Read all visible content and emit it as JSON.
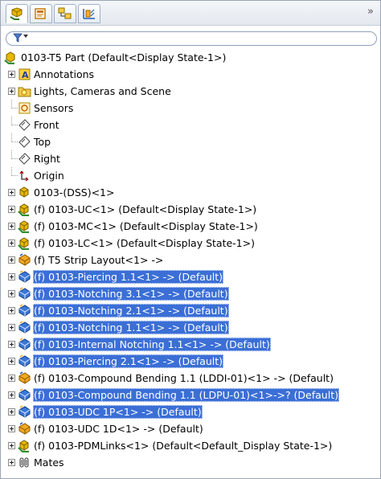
{
  "tabs": [
    {
      "name": "featuremanager-tab",
      "active": true
    },
    {
      "name": "propertymanager-tab",
      "active": false
    },
    {
      "name": "configurationmanager-tab",
      "active": false
    },
    {
      "name": "dimxpert-tab",
      "active": false
    }
  ],
  "overflow_label": "»",
  "filter": {
    "placeholder": ""
  },
  "root": {
    "label": "0103-T5 Part  (Default<Display State-1>)"
  },
  "items": [
    {
      "label": "Annotations",
      "icon": "annotations-icon",
      "expand": true,
      "sel": false
    },
    {
      "label": "Lights, Cameras and Scene",
      "icon": "lights-folder-icon",
      "expand": true,
      "sel": false
    },
    {
      "label": "Sensors",
      "icon": "sensors-icon",
      "expand": false,
      "sel": false
    },
    {
      "label": "Front",
      "icon": "plane-icon",
      "expand": false,
      "sel": false
    },
    {
      "label": "Top",
      "icon": "plane-icon",
      "expand": false,
      "sel": false
    },
    {
      "label": "Right",
      "icon": "plane-icon",
      "expand": false,
      "sel": false
    },
    {
      "label": "Origin",
      "icon": "origin-icon",
      "expand": false,
      "sel": false
    },
    {
      "label": "0103-(DSS)<1>",
      "icon": "assembly-icon",
      "expand": true,
      "sel": false
    },
    {
      "label": "(f) 0103-UC<1> (Default<Display State-1>)",
      "icon": "assembly-green-icon",
      "expand": true,
      "sel": false
    },
    {
      "label": "(f) 0103-MC<1> (Default<Display State-1>)",
      "icon": "assembly-green-icon",
      "expand": true,
      "sel": false
    },
    {
      "label": "(f) 0103-LC<1> (Default<Display State-1>)",
      "icon": "assembly-green-icon",
      "expand": true,
      "sel": false
    },
    {
      "label": "(f) T5 Strip Layout<1> ->",
      "icon": "part-icon",
      "expand": true,
      "sel": false
    },
    {
      "label": "(f) 0103-Piercing 1.1<1> -> (Default)",
      "icon": "part-blue-icon",
      "expand": true,
      "sel": true
    },
    {
      "label": "(f) 0103-Notching 3.1<1> -> (Default)",
      "icon": "part-blue-icon",
      "expand": true,
      "sel": true
    },
    {
      "label": "(f) 0103-Notching 2.1<1> -> (Default)",
      "icon": "part-blue-icon",
      "expand": true,
      "sel": true
    },
    {
      "label": "(f) 0103-Notching 1.1<1> -> (Default)",
      "icon": "part-blue-icon",
      "expand": true,
      "sel": true
    },
    {
      "label": "(f) 0103-Internal Notching 1.1<1> -> (Default)",
      "icon": "part-blue-icon",
      "expand": true,
      "sel": true
    },
    {
      "label": "(f) 0103-Piercing 2.1<1> -> (Default)",
      "icon": "part-blue-icon",
      "expand": true,
      "sel": true
    },
    {
      "label": "(f) 0103-Compound Bending 1.1 (LDDI-01)<1> -> (Default)",
      "icon": "part-icon",
      "expand": true,
      "sel": false
    },
    {
      "label": "(f) 0103-Compound Bending 1.1 (LDPU-01)<1>->? (Default)",
      "icon": "part-blue-icon",
      "expand": true,
      "sel": true
    },
    {
      "label": "(f) 0103-UDC 1P<1> -> (Default)",
      "icon": "part-blue-icon",
      "expand": true,
      "sel": true
    },
    {
      "label": "(f) 0103-UDC 1D<1> -> (Default)",
      "icon": "part-icon",
      "expand": true,
      "sel": false
    },
    {
      "label": "(f) 0103-PDMLinks<1> (Default<Default_Display State-1>)",
      "icon": "assembly-green-icon",
      "expand": true,
      "sel": false
    },
    {
      "label": "Mates",
      "icon": "mates-icon",
      "expand": true,
      "sel": false
    }
  ],
  "colors": {
    "selection": "#3b6fd6",
    "accent_green": "#2f8f2f",
    "part_yellow": "#e0a800"
  }
}
